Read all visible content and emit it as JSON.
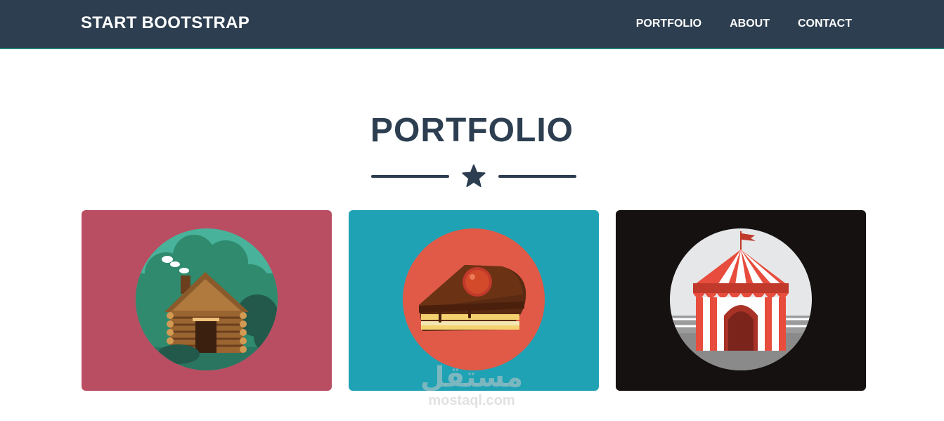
{
  "navbar": {
    "brand": "START BOOTSTRAP",
    "links": [
      "PORTFOLIO",
      "ABOUT",
      "CONTACT"
    ]
  },
  "portfolio": {
    "title": "PORTFOLIO",
    "items": [
      {
        "name": "cabin",
        "bg": "#b94e62"
      },
      {
        "name": "cake",
        "bg": "#20a2b5"
      },
      {
        "name": "circus",
        "bg": "#141110"
      }
    ]
  },
  "colors": {
    "navbar": "#2c3e50",
    "accent": "#1abc9c",
    "heading": "#2c3e50"
  },
  "watermark": {
    "arabic": "مستقل",
    "latin": "mostaql.com"
  }
}
